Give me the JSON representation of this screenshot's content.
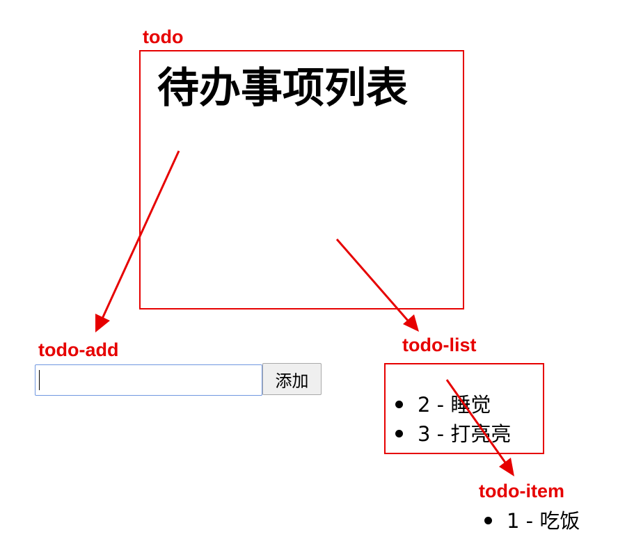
{
  "labels": {
    "todo": "todo",
    "todo_add": "todo-add",
    "todo_list": "todo-list",
    "todo_item": "todo-item"
  },
  "todo": {
    "title": "待办事项列表"
  },
  "todo_add": {
    "input_value": "",
    "button_label": "添加"
  },
  "todo_list": {
    "items": [
      {
        "text": "2 - 睡觉"
      },
      {
        "text": "3 - 打亮亮"
      }
    ]
  },
  "todo_item": {
    "text": "1 - 吃饭"
  },
  "colors": {
    "annotation": "#e60000",
    "input_focus_border": "#6f97e0",
    "button_background": "#efefef"
  }
}
